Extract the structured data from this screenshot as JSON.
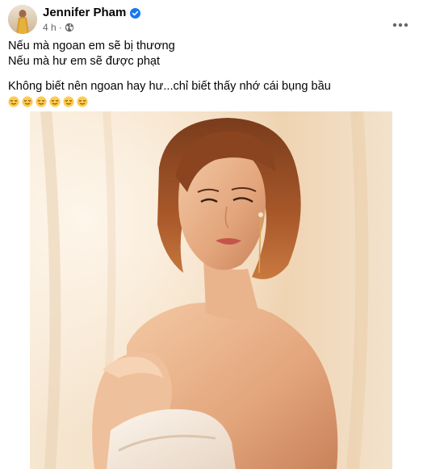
{
  "post": {
    "author": {
      "name": "Jennifer Pham",
      "verified": true,
      "avatar_icon": "avatar"
    },
    "timestamp": "4 h",
    "separator": "·",
    "audience_icon": "globe-icon",
    "more_icon": "more-options-icon",
    "text": {
      "line_1": "Nếu mà ngoan em sẽ bị thương",
      "line_2": "Nếu mà hư em sẽ được phạt",
      "line_3": "Không biết nên ngoan hay hư...chỉ biết thấy nhớ cái bụng bầu",
      "emoji_count": 6,
      "emoji_name": "relieved-face-emoji"
    },
    "photo": {
      "subject": "portrait-photo"
    },
    "colors": {
      "verified_blue": "#1877f2",
      "secondary_text": "#65676b",
      "primary_text": "#050505",
      "emoji_yellow": "#ffcc4d"
    }
  }
}
